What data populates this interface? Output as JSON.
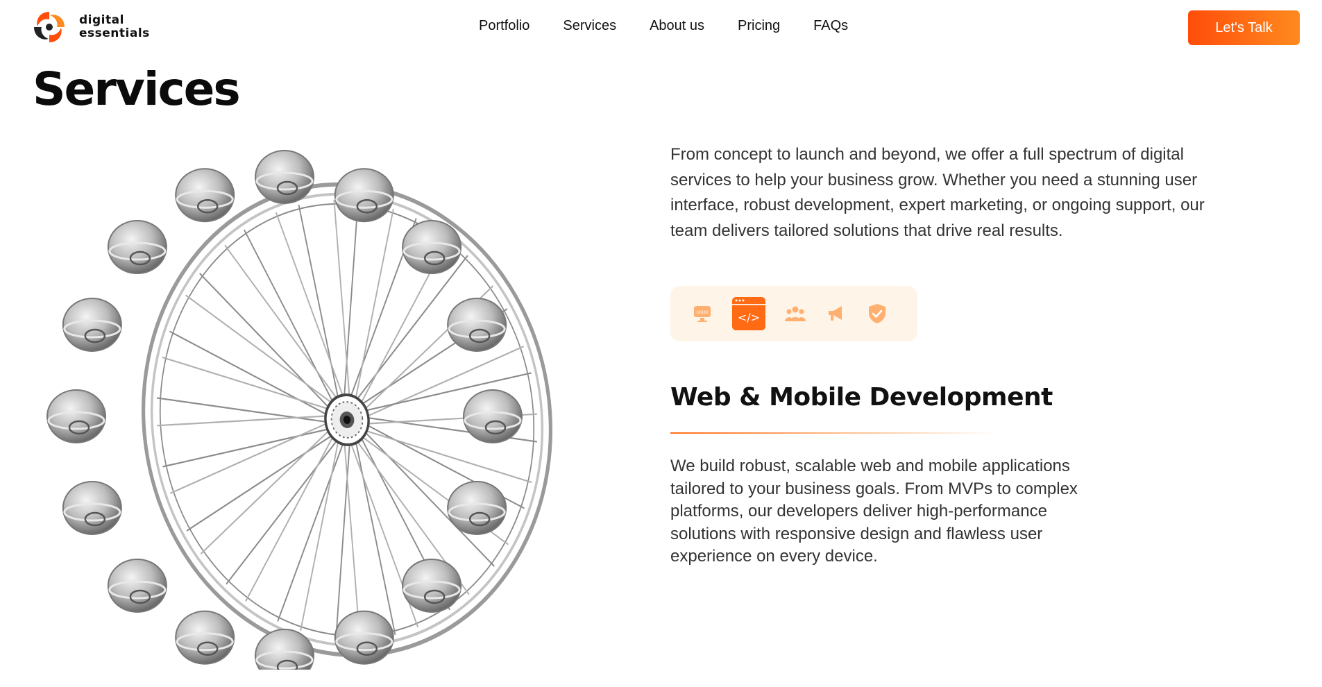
{
  "brand": {
    "line1": "digital",
    "line2": "essentials"
  },
  "nav": {
    "items": [
      "Portfolio",
      "Services",
      "About us",
      "Pricing",
      "FAQs"
    ]
  },
  "header": {
    "cta_label": "Let's Talk"
  },
  "page": {
    "title": "Services"
  },
  "intro": {
    "text": "From concept to launch and beyond, we offer a full spectrum of digital services to help your business grow. Whether you need a stunning user interface, robust development, expert marketing, or ongoing support, our team delivers tailored solutions that drive real results."
  },
  "service_tabs": [
    {
      "icon": "ui-ux-monitor-icon",
      "label": "UI/UX",
      "active": false
    },
    {
      "icon": "code-window-icon",
      "label": "</>",
      "active": true
    },
    {
      "icon": "team-icon",
      "active": false
    },
    {
      "icon": "megaphone-icon",
      "active": false
    },
    {
      "icon": "shield-check-icon",
      "active": false
    }
  ],
  "service": {
    "title": "Web & Mobile Development",
    "description": "We build robust, scalable web and mobile applications tailored to your business goals. From MVPs to complex platforms, our developers deliver high-performance solutions with responsive design and flawless user experience on every device."
  },
  "colors": {
    "accent": "#ff6a14",
    "accent_light": "#fff4e8",
    "cta_start": "#ff4d0a",
    "cta_end": "#ff8a1f"
  }
}
